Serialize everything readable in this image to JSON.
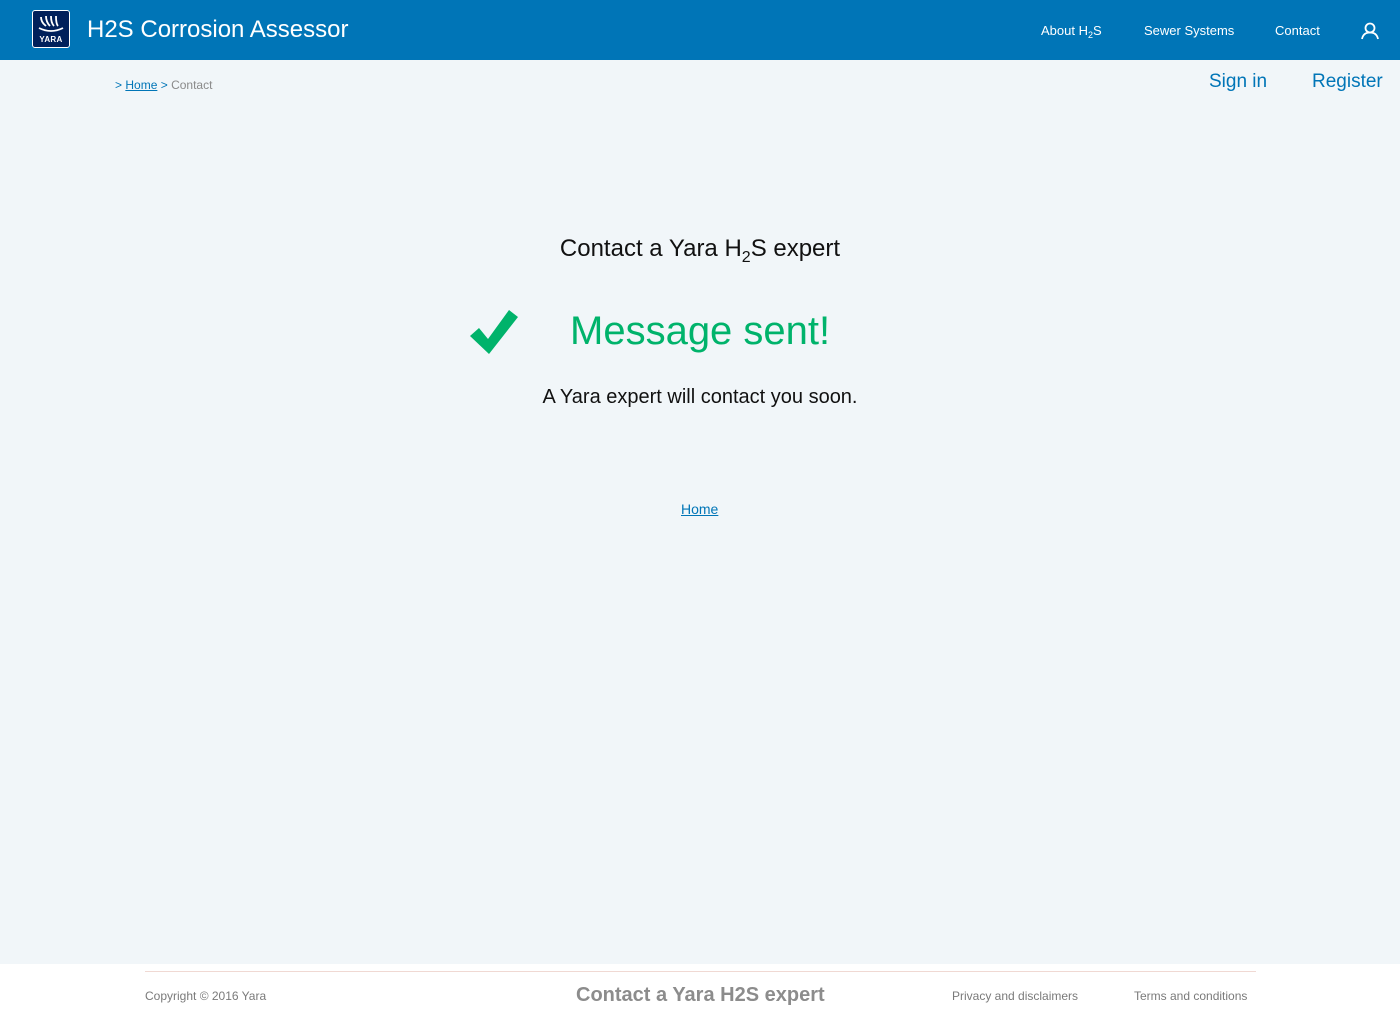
{
  "header": {
    "logo_text": "YARA",
    "app_title": "H2S Corrosion Assessor",
    "nav": {
      "about_prefix": "About H",
      "about_sub": "2",
      "about_suffix": "S",
      "sewer": "Sewer Systems",
      "contact": "Contact"
    },
    "user_icon": "user-icon"
  },
  "breadcrumb": {
    "sep1": ">",
    "home": "Home",
    "sep2": ">",
    "current": "Contact"
  },
  "auth": {
    "sign_in": "Sign in",
    "register": "Register"
  },
  "main": {
    "title_prefix": "Contact a Yara H",
    "title_sub": "2",
    "title_suffix": "S expert",
    "success_icon": "checkmark-icon",
    "success_message": "Message sent!",
    "sub_message": "A Yara expert will contact you soon.",
    "home_link": "Home"
  },
  "footer": {
    "copyright": "Copyright  © 2016 Yara",
    "cta": "Contact a Yara H2S expert",
    "privacy": "Privacy and disclaimers",
    "terms": "Terms and conditions"
  },
  "colors": {
    "brand_blue": "#0075b7",
    "logo_navy": "#00205b",
    "success_green": "#00b36b",
    "page_bg": "#f1f6f9"
  }
}
